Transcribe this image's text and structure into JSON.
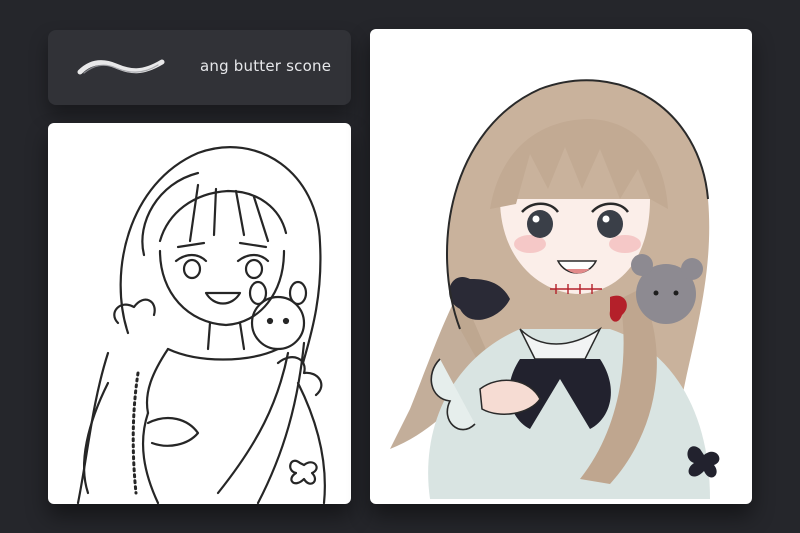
{
  "brush": {
    "name": "ang butter scone",
    "stroke_icon": "brush-stroke-preview"
  },
  "colors": {
    "background": "#25262b",
    "panel": "#313237",
    "card": "#ffffff",
    "hair": "#c9b29c",
    "hair_shadow": "#a08a77",
    "ribbon": "#22222e",
    "accent_red": "#b4202a",
    "line": "#2a2a2a"
  }
}
